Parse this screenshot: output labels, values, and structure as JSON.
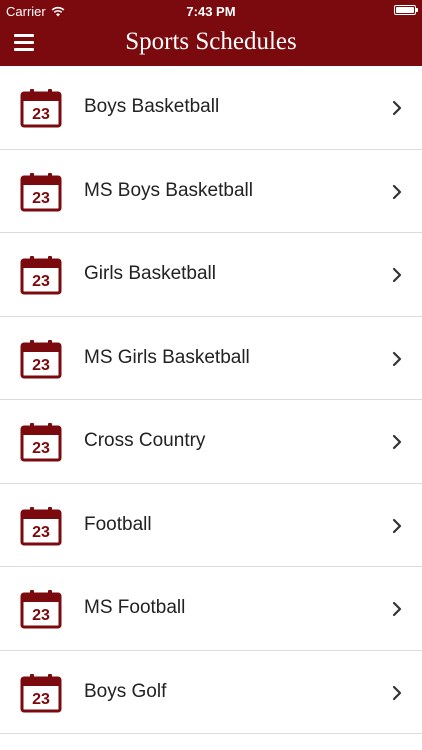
{
  "colors": {
    "brand": "#7a0a0e",
    "text": "#222222",
    "divider": "#dcdcdc",
    "background": "#ffffff"
  },
  "status_bar": {
    "carrier": "Carrier",
    "time": "7:43 PM"
  },
  "header": {
    "title": "Sports Schedules",
    "menu_icon": "hamburger-icon"
  },
  "list": {
    "item_icon": "calendar-icon",
    "calendar_day": "23",
    "chevron_icon": "chevron-right-icon",
    "items": [
      {
        "label": "Boys Basketball"
      },
      {
        "label": "MS Boys Basketball"
      },
      {
        "label": "Girls Basketball"
      },
      {
        "label": "MS Girls Basketball"
      },
      {
        "label": "Cross Country"
      },
      {
        "label": "Football"
      },
      {
        "label": "MS Football"
      },
      {
        "label": "Boys Golf"
      }
    ]
  }
}
